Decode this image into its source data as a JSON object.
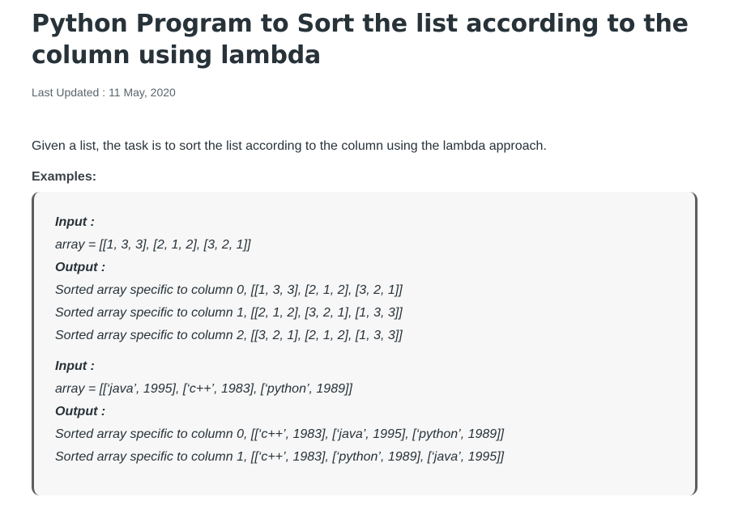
{
  "article": {
    "title": "Python Program to Sort the list according to the column using lambda",
    "last_updated_label": "Last Updated :",
    "last_updated_date": "11 May, 2020",
    "intro": "Given a list, the task is to sort the list according to the column using the lambda approach.",
    "examples_heading": "Examples:"
  },
  "examples": [
    {
      "input_label": "Input :",
      "input": "array = [[1, 3, 3], [2, 1, 2], [3, 2, 1]]",
      "output_label": "Output :",
      "outputs": [
        "Sorted array specific to column 0, [[1, 3, 3], [2, 1, 2], [3, 2, 1]]",
        "Sorted array specific to column 1, [[2, 1, 2], [3, 2, 1], [1, 3, 3]]",
        "Sorted array specific to column 2, [[3, 2, 1], [2, 1, 2], [1, 3, 3]]"
      ]
    },
    {
      "input_label": "Input :",
      "input": "array = [[‘java’, 1995], [‘c++’, 1983], [‘python’, 1989]]",
      "output_label": "Output :",
      "outputs": [
        "Sorted array specific to column 0, [[‘c++’, 1983], [‘java’, 1995], [‘python’, 1989]]",
        "Sorted array specific to column 1, [[‘c++’, 1983], [‘python’, 1989], [‘java’, 1995]]"
      ]
    }
  ]
}
